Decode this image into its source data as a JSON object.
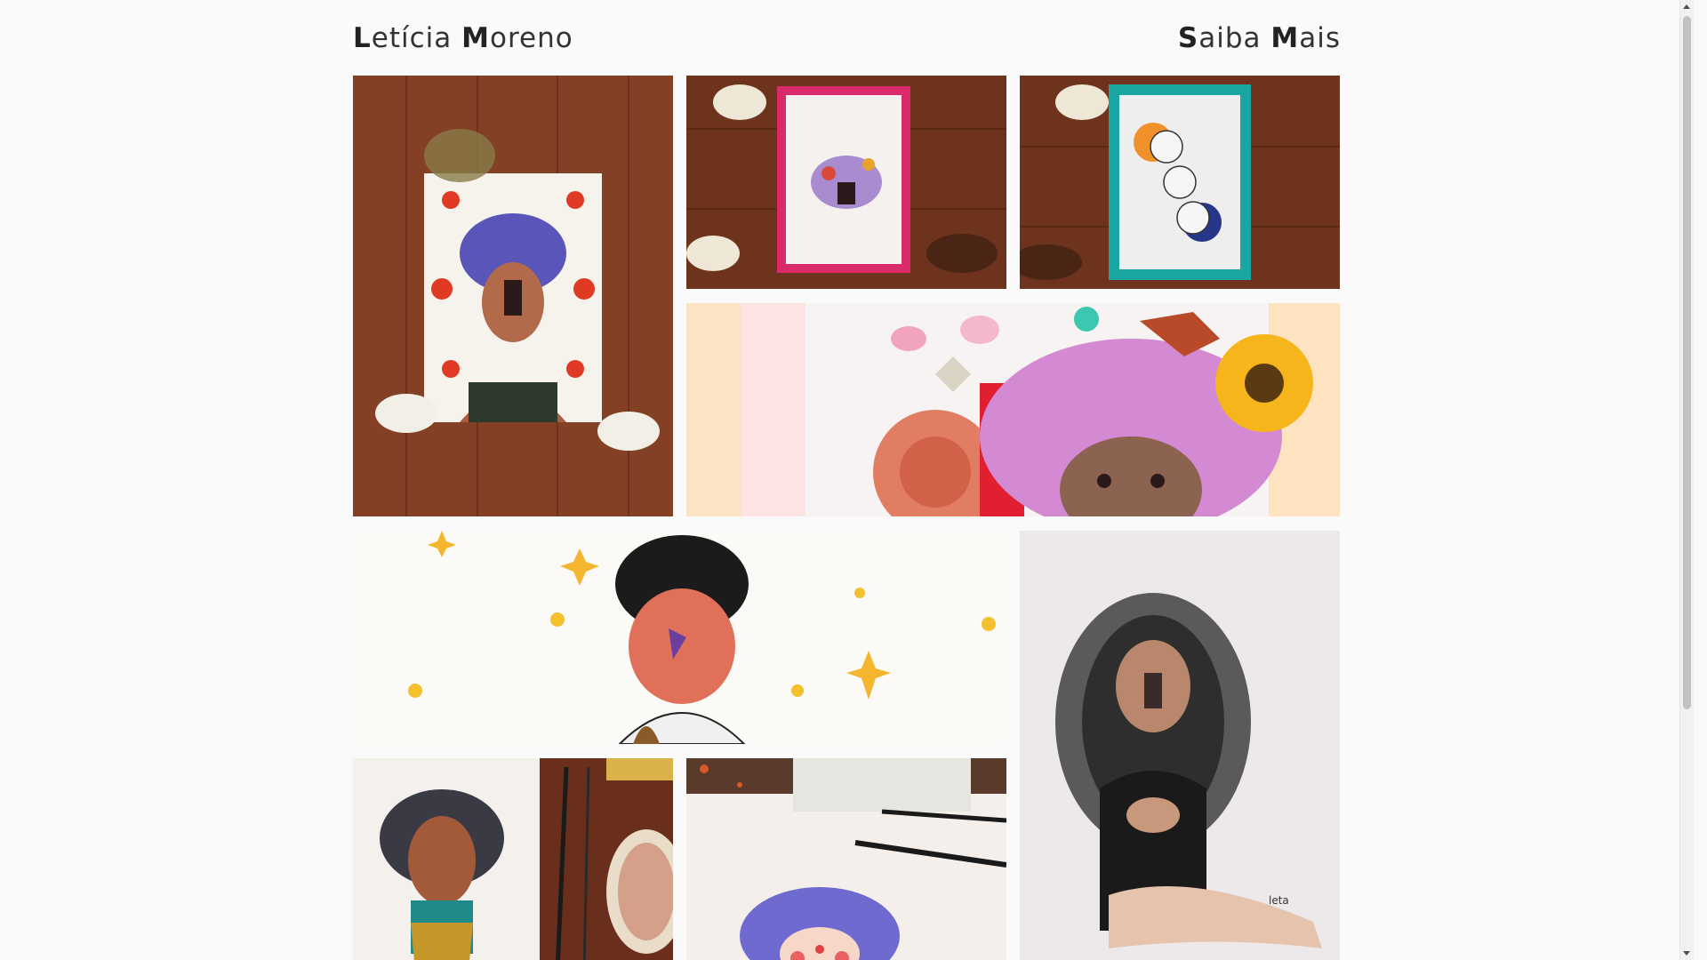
{
  "header": {
    "brand_initial_1": "L",
    "brand_rest_1": "etícia ",
    "brand_initial_2": "M",
    "brand_rest_2": "oreno",
    "more_initial_1": "S",
    "more_rest_1": "aiba ",
    "more_initial_2": "M",
    "more_rest_2": "ais"
  },
  "gallery": {
    "tiles": [
      {
        "subject": "watercolor portrait with red flowers on wood table",
        "icon": "artwork-image"
      },
      {
        "subject": "framed illustration in pink frame",
        "icon": "artwork-image"
      },
      {
        "subject": "framed faces illustration in teal frame",
        "icon": "artwork-image"
      },
      {
        "subject": "collage with pink hair, flowers and butterflies",
        "icon": "artwork-image"
      },
      {
        "subject": "girl with curly hair and stars",
        "icon": "artwork-image"
      },
      {
        "subject": "ink woman sitting illustration",
        "icon": "artwork-image"
      },
      {
        "subject": "watercolor portrait with brushes",
        "icon": "artwork-image"
      },
      {
        "subject": "blue hair watercolor with brushes",
        "icon": "artwork-image"
      }
    ]
  },
  "colors": {
    "background": "#fafafa",
    "text": "#333333"
  }
}
